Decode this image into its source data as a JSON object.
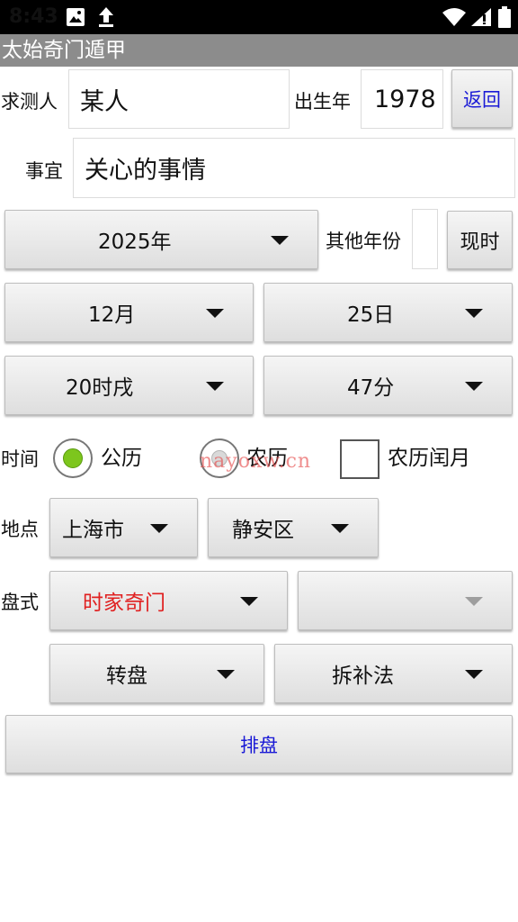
{
  "status": {
    "time": "8:43"
  },
  "app": {
    "title": "太始奇门遁甲"
  },
  "form": {
    "person_label": "求测人",
    "person_value": "某人",
    "birth_year_label": "出生年",
    "birth_year_value": "1978",
    "back_button": "返回",
    "matter_label": "事宜",
    "matter_value": "关心的事情",
    "year_selected": "2025年",
    "other_year_label": "其他年份",
    "other_year_value": "",
    "now_button": "现时",
    "month_selected": "12月",
    "day_selected": "25日",
    "hour_selected": "20时戌",
    "minute_selected": "47分",
    "time_label": "时间",
    "calendar_options": [
      "公历",
      "农历"
    ],
    "calendar_selected": "公历",
    "leap_month_label": "农历闰月",
    "leap_month_checked": false,
    "location_label": "地点",
    "city_selected": "上海市",
    "district_selected": "静安区",
    "chart_style_label": "盘式",
    "chart_type_selected": "时家奇门",
    "chart_subtype_selected": "",
    "method_selected": "转盘",
    "rule_selected": "拆补法",
    "arrange_button": "排盘"
  },
  "watermark": "nayoxw.cn",
  "colors": {
    "accent_blue": "#1a1ad6",
    "chart_type_red": "#e02020",
    "radio_selected": "#7dc61d",
    "title_bar": "#8c8c8c"
  },
  "icons": [
    "image-icon",
    "download-icon",
    "wifi-icon",
    "signal-icon",
    "battery-icon"
  ]
}
